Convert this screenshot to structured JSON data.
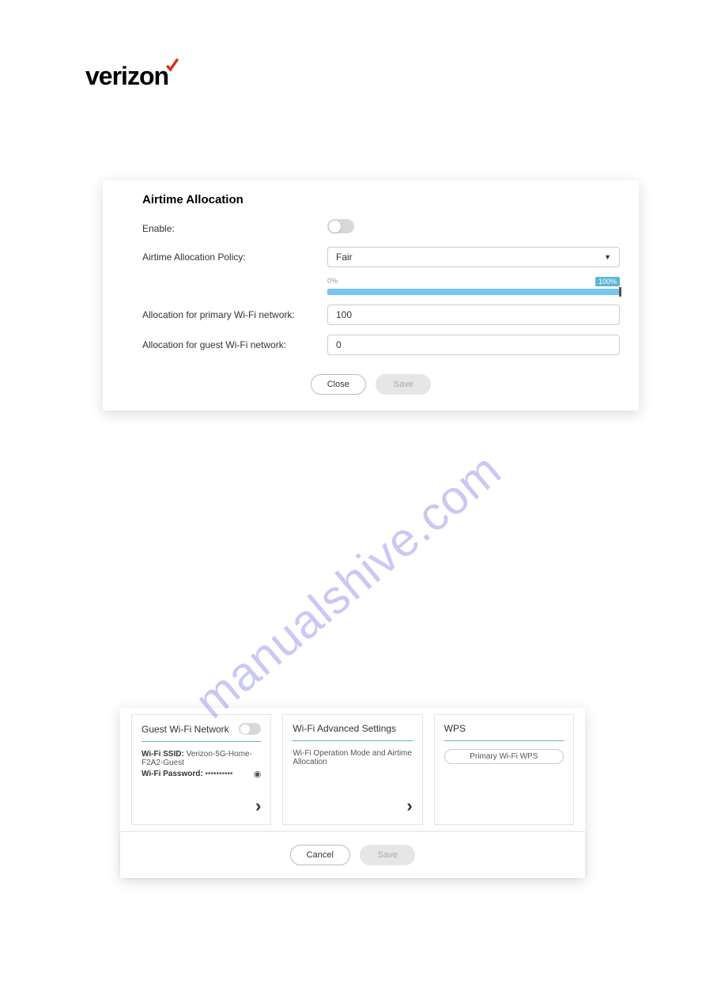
{
  "logo_text": "verizon",
  "panel1": {
    "title": "Airtime Allocation",
    "enable_label": "Enable:",
    "policy_label": "Airtime Allocation Policy:",
    "policy_value": "Fair",
    "slider_min_label": "0%",
    "slider_max_label": "100%",
    "primary_label": "Allocation for primary Wi-Fi network:",
    "primary_value": "100",
    "guest_label": "Allocation for guest Wi-Fi network:",
    "guest_value": "0",
    "close_btn": "Close",
    "save_btn": "Save"
  },
  "watermark_text": "manualshive.com",
  "panel2": {
    "card1": {
      "title": "Guest Wi-Fi Network",
      "ssid_label": "Wi-Fi SSID:",
      "ssid_value": "Verizon-5G-Home-F2A2-Guest",
      "pwd_label": "Wi-Fi Password:",
      "pwd_value": "••••••••••"
    },
    "card2": {
      "title": "Wi-Fi Advanced Settings",
      "desc": "Wi-Fi Operation Mode and Airtime Allocation"
    },
    "card3": {
      "title": "WPS",
      "btn_label": "Primary Wi-Fi WPS"
    },
    "cancel_btn": "Cancel",
    "save_btn": "Save"
  }
}
